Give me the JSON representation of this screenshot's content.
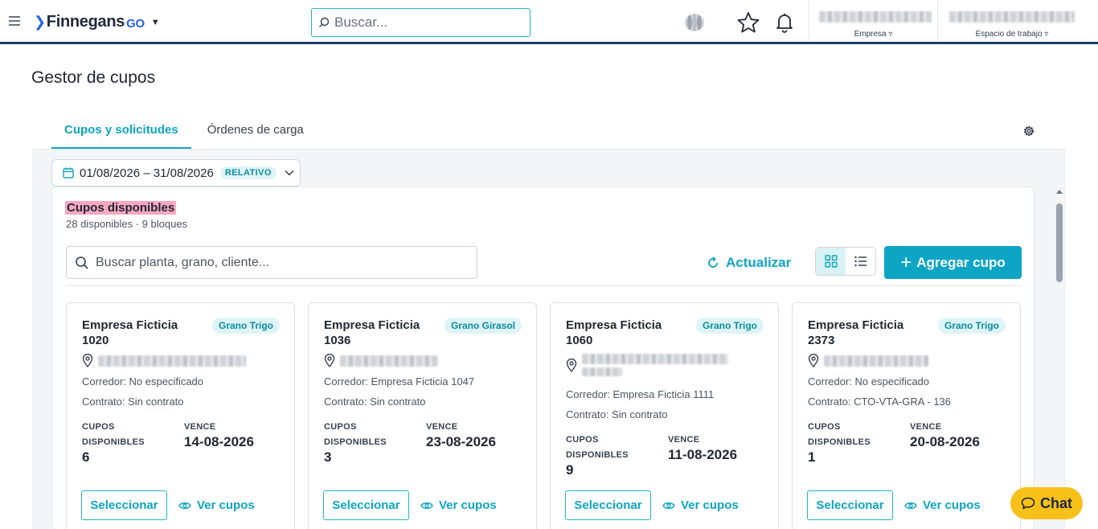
{
  "header": {
    "brand": "Finnegans",
    "brand_suffix": "GO",
    "search_placeholder": "Buscar...",
    "empresa_label": "Empresa",
    "espacio_label": "Espacio de trabajo",
    "icons": [
      "menu-icon",
      "brand-chevron-icon",
      "search-icon",
      "logo-mark-icon",
      "star-icon",
      "bell-icon"
    ]
  },
  "page": {
    "title": "Gestor de cupos",
    "tabs": [
      {
        "label": "Cupos y solicitudes",
        "active": true
      },
      {
        "label": "Órdenes de carga",
        "active": false
      }
    ]
  },
  "filters": {
    "date_range": "01/08/2026 – 31/08/2026",
    "date_mode": "RELATIVO"
  },
  "panel": {
    "title": "Cupos disponibles",
    "subtitle": "28 disponibles · 9 bloques",
    "search_placeholder": "Buscar planta, grano, cliente...",
    "refresh_label": "Actualizar",
    "add_label": "Agregar cupo",
    "view_mode": "grid"
  },
  "cards": [
    {
      "name": "Empresa Ficticia 1020",
      "grain": "Grano Trigo",
      "corredor": "Corredor: No especificado",
      "contrato": "Contrato: Sin contrato",
      "cupos_label": "CUPOS DISPONIBLES",
      "cupos": "6",
      "vence_label": "VENCE",
      "vence": "14-08-2026",
      "select_label": "Seleccionar",
      "view_label": "Ver cupos"
    },
    {
      "name": "Empresa Ficticia 1036",
      "grain": "Grano Girasol",
      "corredor": "Corredor: Empresa Ficticia 1047",
      "contrato": "Contrato: Sin contrato",
      "cupos_label": "CUPOS DISPONIBLES",
      "cupos": "3",
      "vence_label": "VENCE",
      "vence": "23-08-2026",
      "select_label": "Seleccionar",
      "view_label": "Ver cupos"
    },
    {
      "name": "Empresa Ficticia 1060",
      "grain": "Grano Trigo",
      "corredor": "Corredor: Empresa Ficticia 1111",
      "contrato": "Contrato: Sin contrato",
      "cupos_label": "CUPOS DISPONIBLES",
      "cupos": "9",
      "vence_label": "VENCE",
      "vence": "11-08-2026",
      "select_label": "Seleccionar",
      "view_label": "Ver cupos"
    },
    {
      "name": "Empresa Ficticia 2373",
      "grain": "Grano Trigo",
      "corredor": "Corredor: No especificado",
      "contrato": "Contrato: CTO-VTA-GRA - 136",
      "cupos_label": "CUPOS DISPONIBLES",
      "cupos": "1",
      "vence_label": "VENCE",
      "vence": "20-08-2026",
      "select_label": "Seleccionar",
      "view_label": "Ver cupos"
    }
  ],
  "chat": {
    "label": "Chat"
  },
  "colors": {
    "accent": "#0ea5c4",
    "header_border": "#1f3b6e",
    "highlight": "#f9a8c1",
    "chat": "#f7c11a"
  }
}
